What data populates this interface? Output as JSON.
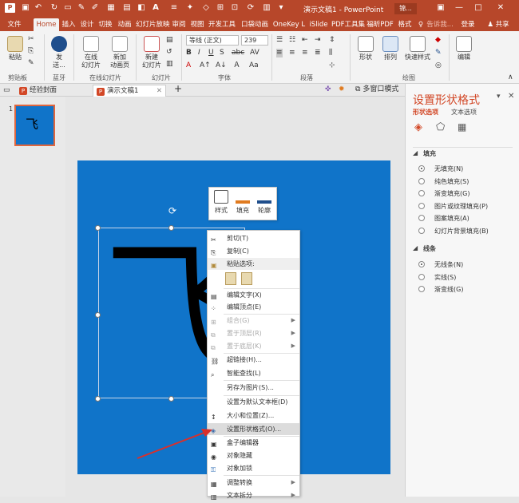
{
  "window": {
    "title": "演示文稿1 - PowerPoint",
    "user_short": "锦...",
    "login": "登录",
    "share": "共享",
    "tellme": "告诉我..."
  },
  "tabs": [
    "文件",
    "Home",
    "插入",
    "设计",
    "切换",
    "动画",
    "幻灯片放映",
    "审阅",
    "视图",
    "开发工具",
    "口袋动画",
    "OneKey L",
    "iSlide",
    "PDF工具集",
    "福昕PDF",
    "格式"
  ],
  "ribbon": {
    "paste": "粘贴",
    "send_1": "发",
    "send_2": "送...",
    "online_1": "在线",
    "online_2": "幻灯片",
    "new_anim_1": "新加",
    "new_anim_2": "动画页",
    "new_slide_1": "新建",
    "new_slide_2": "幻灯片",
    "font_name": "等线 (正文)",
    "font_size": "239",
    "shape": "形状",
    "arrange": "排列",
    "quick_style": "快速样式",
    "edit": "编辑",
    "groups": {
      "clipboard": "剪贴板",
      "bluetooth": "蓝牙",
      "online_slides": "在线幻灯片",
      "slides": "幻灯片",
      "font": "字体",
      "paragraph": "段落",
      "drawing": "绘图"
    }
  },
  "doc_tabs": {
    "tab1": "经验封面",
    "tab2": "演示文稿1",
    "multi_window": "多窗口模式"
  },
  "thumbnail": {
    "number": "1"
  },
  "slide": {
    "text": "飞"
  },
  "mini_toolbar": {
    "style": "样式",
    "fill": "填充",
    "outline": "轮廓"
  },
  "context_menu": {
    "cut": "剪切(T)",
    "copy": "复制(C)",
    "paste_options": "粘贴选项:",
    "edit_text": "编辑文字(X)",
    "edit_points": "编辑顶点(E)",
    "group": "组合(G)",
    "bring_front": "置于顶层(R)",
    "send_back": "置于底层(K)",
    "hyperlink": "超链接(H)...",
    "smart_lookup": "智能查找(L)",
    "save_as_picture": "另存为图片(S)...",
    "set_default": "设置为默认文本框(D)",
    "size_position": "大小和位置(Z)...",
    "format_shape": "设置形状格式(O)...",
    "box_editor": "盒子编辑器",
    "hide_object": "对象隐藏",
    "lock_object": "对象加锁",
    "adjust_convert": "调整转换",
    "text_split": "文本拆分"
  },
  "format_pane": {
    "title": "设置形状格式",
    "tab_shape": "形状选项",
    "tab_text": "文本选项",
    "fill_header": "填充",
    "fill_options": [
      "无填充(N)",
      "纯色填充(S)",
      "渐变填充(G)",
      "图片或纹理填充(P)",
      "图案填充(A)",
      "幻灯片背景填充(B)"
    ],
    "line_header": "线条",
    "line_options": [
      "无线条(N)",
      "实线(S)",
      "渐变线(G)"
    ]
  },
  "colors": {
    "accent": "#b7472a",
    "slide_bg": "#1074c9",
    "pane_accent": "#d24726"
  }
}
